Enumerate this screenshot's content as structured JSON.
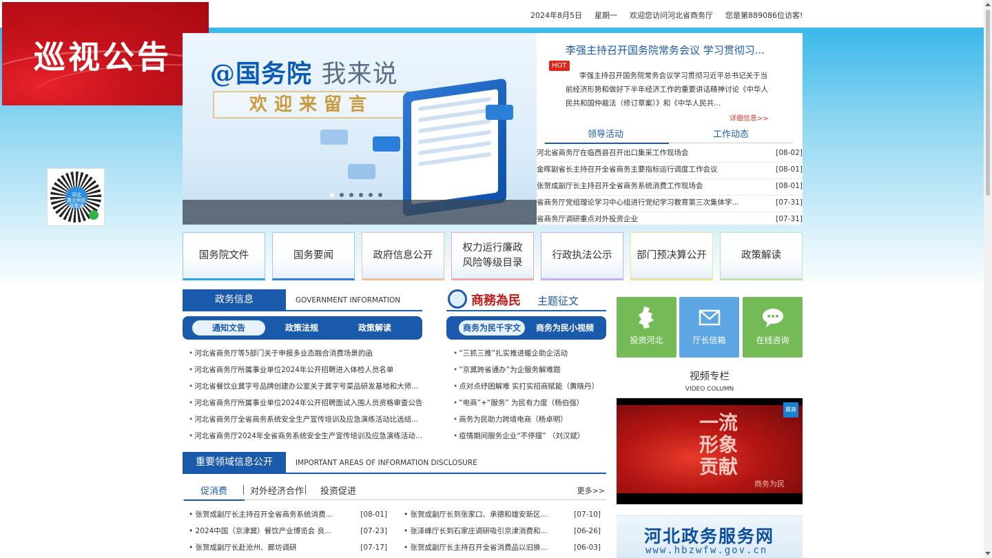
{
  "topbar": {
    "date": "2024年8月5日",
    "weekday": "星期一",
    "welcome": "欢迎您访问河北省商务厅",
    "visitor": "您是第889086位访客!"
  },
  "patrol_banner": {
    "title": "巡视公告"
  },
  "qr": {
    "line1": "河北",
    "line2": "惠企利民",
    "line3": "政策通"
  },
  "hero": {
    "title_main": "@国务院",
    "title_light": "我来说",
    "subtitle": "欢迎来留言"
  },
  "headline": {
    "title": "李强主持召开国务院常务会议 学习贯彻习...",
    "hot": "HOT",
    "body": "李强主持召开国务院常务会议学习贯彻习近平总书记关于当前经济形势和做好下半年经济工作的重要讲话精神讨论《中华人民共和国仲裁法（修订草案）》和《中华人民共...",
    "detail": "详细信息>>"
  },
  "lead_tabs": [
    "领导活动",
    "工作动态"
  ],
  "lead_news": [
    {
      "title": "河北省商务厅在临西县召开出口集采工作现场会",
      "date": "[08-02]"
    },
    {
      "title": "金晖副省长主持召开全省商务主要指标运行调度工作会议",
      "date": "[08-01]"
    },
    {
      "title": "张贺成副厅长主持召开全省商务系统消费工作现场会",
      "date": "[08-01]"
    },
    {
      "title": "省商务厅党组理论学习中心组进行党纪学习教育第三次集体学...",
      "date": "[07-31]"
    },
    {
      "title": "省商务厅调研重点对外投资企业",
      "date": "[07-31]"
    }
  ],
  "tiles": [
    {
      "line1": "国务院文件",
      "line2": ""
    },
    {
      "line1": "国务要闻",
      "line2": ""
    },
    {
      "line1": "政府信息公开",
      "line2": ""
    },
    {
      "line1": "权力运行廉政",
      "line2": "风险等级目录"
    },
    {
      "line1": "行政执法公示",
      "line2": ""
    },
    {
      "line1": "部门预决算公开",
      "line2": ""
    },
    {
      "line1": "政策解读",
      "line2": ""
    }
  ],
  "gov_info": {
    "cn": "政务信息",
    "en": "GOVERNMENT INFORMATION",
    "pills": [
      "通知文告",
      "政策法规",
      "政策解读"
    ],
    "items": [
      "河北省商务厅等5部门关于申报多业态融合消费场景的函",
      "河北省商务厅所属事业单位2024年公开招聘进入体检人员名单",
      "河北省餐饮业冀字号品牌创建办公室关于冀字号菜品研发基地和大师...",
      "河北省商务厅所属事业单位2024年公开招聘面试入围人员资格审查公告",
      "河北省商务厅全省商务系统安全生产宣传培训及应急演练活动比选结...",
      "河北省商务厅2024年全省商务系统安全生产宣传培训及应急演练活动..."
    ]
  },
  "commerce": {
    "brand": "商務為民",
    "title": "主题征文",
    "pills": [
      "商务为民千字文",
      "商务为民小视频"
    ],
    "items": [
      "“三抓三推”扎实推进暖企助企活动",
      "“京冀跨省通办”为企服务解难题",
      "点对点纾困解难 实打实招商赋能（黄晓丹）",
      "“电商”+“服务” 为民有力度（杨伯强）",
      "商务为民助力跨境电商（杨卓明）",
      "疫情期间服务企业“不停摆” （刘汉斌）"
    ]
  },
  "services": [
    {
      "label": "投资河北",
      "icon": "hebei-map-icon"
    },
    {
      "label": "厅长信箱",
      "icon": "mail-icon"
    },
    {
      "label": "在线咨询",
      "icon": "chat-icon"
    }
  ],
  "video": {
    "cn": "视频专栏",
    "en": "VIDEO COLUMN",
    "overlay": "一流\n形象\n贡献",
    "badge": "冀商",
    "caption": "商务为民"
  },
  "hbzw": {
    "cn": "河北政务服务网",
    "url": "www.hbzwfw.gov.cn"
  },
  "areas": {
    "cn": "重要领域信息公开",
    "en": "IMPORTANT AREAS OF INFORMATION DISCLOSURE",
    "tabs": [
      "促消费",
      "对外经济合作",
      "投资促进"
    ],
    "more": "更多>>",
    "left": [
      {
        "title": "张贺成副厅长主持召开全省商务系统消费...",
        "date": "[08-01]"
      },
      {
        "title": "2024中国（京津冀）餐饮产业博览会 良...",
        "date": "[07-23]"
      },
      {
        "title": "张贺成副厅长赴沧州、廊坊调研",
        "date": "[07-17]"
      }
    ],
    "right": [
      {
        "title": "张贺成副厅长到张家口、承德和雄安新区...",
        "date": "[07-10]"
      },
      {
        "title": "张泽峰厅长到石家庄调研吸引京津消费和...",
        "date": "[06-26]"
      },
      {
        "title": "张贺成副厅长主持召开全省消费品以旧换...",
        "date": "[06-03]"
      }
    ]
  },
  "colors": {
    "brand_blue": "#1a5aad",
    "hot_red": "#e0261b",
    "service_green": "#74bb57",
    "service_blue": "#5da6e4"
  }
}
